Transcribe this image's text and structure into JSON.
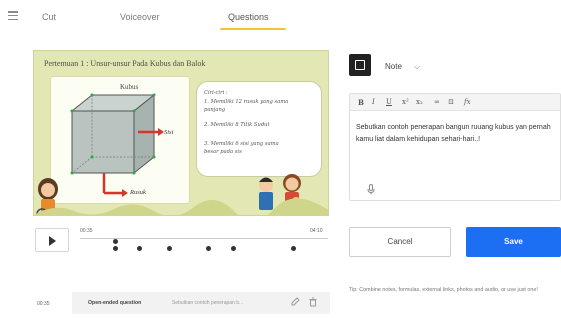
{
  "tabs": [
    {
      "label": "Cut"
    },
    {
      "label": "Voiceover"
    },
    {
      "label": "Questions",
      "active": true
    }
  ],
  "accent_color": "#f4c531",
  "video": {
    "title": "Pertemuan 1 : Unsur-unsur Pada Kubus dan Balok",
    "kubus_label": "Kubus",
    "sisi_label": "Sisi",
    "rusuk_label": "Rusuk",
    "notes": [
      "Ciri-ciri :",
      "1. Memiliki 12 rusuk yang sama",
      "   panjang",
      "2. Memiliki 8 Titik Sudut",
      "3. Memiliki 6 sisi yang sama",
      "   besar pada sis"
    ]
  },
  "player": {
    "play_icon": "play-icon",
    "time_start": "00:35",
    "time_end": "04:10",
    "markers": [
      0.145,
      0.24,
      0.36,
      0.52,
      0.62,
      0.86
    ]
  },
  "question": {
    "time": "00:35",
    "type": "Open-ended question",
    "text": "Sebutkan contoh penerapan b...",
    "edit_icon": "pencil-icon",
    "delete_icon": "trash-icon"
  },
  "note_panel": {
    "icon": "note-icon",
    "label": "Note",
    "chevron": "chevron-down-icon",
    "toolbar": [
      "B",
      "I",
      "U",
      "x²",
      "x₂",
      "∞",
      "⊡",
      "fx"
    ],
    "content": "Sebutkan contoh penerapan bangun ruuang kubus yan pernah kamu liat dalam kehidupan sehari-hari..!",
    "mic_icon": "microphone-icon"
  },
  "buttons": {
    "cancel": "Cancel",
    "save": "Save",
    "save_color": "#1c6ff3"
  },
  "tip": "Tip: Combine notes, formulas, external links, photos and audio, or use just one!"
}
